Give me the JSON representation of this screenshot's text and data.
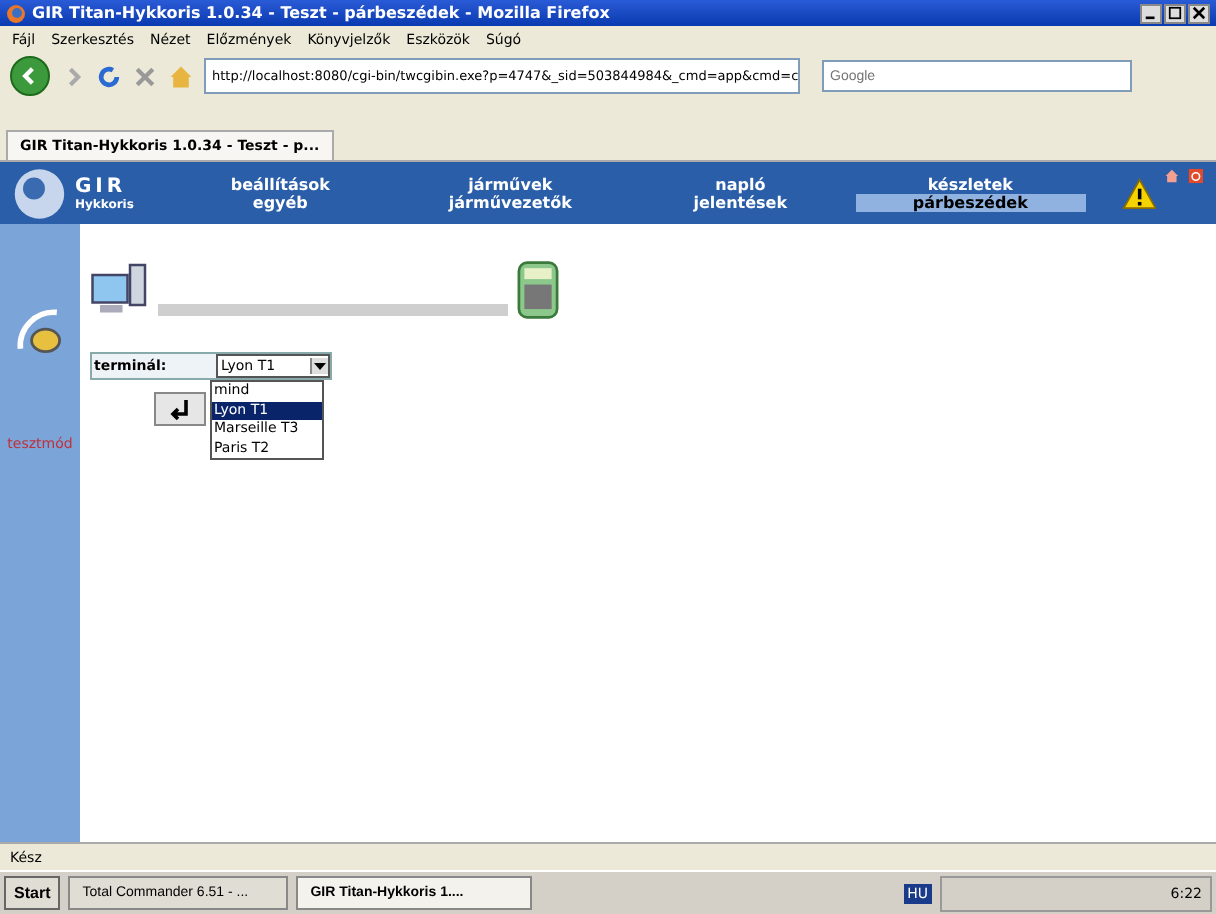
{
  "window": {
    "title": "GIR Titan-Hykkoris 1.0.34 - Teszt - párbeszédek - Mozilla Firefox"
  },
  "menu": [
    "Fájl",
    "Szerkesztés",
    "Nézet",
    "Előzmények",
    "Könyvjelzők",
    "Eszközök",
    "Súgó"
  ],
  "toolbar": {
    "url": "http://localhost:8080/cgi-bin/twcgibin.exe?p=4747&_sid=503844984&_cmd=app&cmd=c",
    "search_placeholder": "Google"
  },
  "tabs": [
    {
      "label": "GIR Titan-Hykkoris 1.0.34 - Teszt - p...",
      "selected": true
    }
  ],
  "app": {
    "logo_title": "GIR",
    "logo_subtitle": "Hykkoris",
    "nav": [
      {
        "label": "beállítások",
        "selected": false
      },
      {
        "label": "járművek",
        "selected": false
      },
      {
        "label": "napló",
        "selected": false
      },
      {
        "label": "készletek",
        "selected": false
      },
      {
        "label": "egyéb",
        "selected": false
      },
      {
        "label": "járművezetők",
        "selected": false
      },
      {
        "label": "jelentések",
        "selected": false
      },
      {
        "label": "párbeszédek",
        "selected": true
      }
    ],
    "sidebar_label": "tesztmód",
    "form": {
      "label": "terminál:",
      "value": "Lyon T1",
      "options": [
        {
          "label": "mind",
          "selected": false
        },
        {
          "label": "Lyon T1",
          "selected": true
        },
        {
          "label": "Marseille T3",
          "selected": false
        },
        {
          "label": "Paris T2",
          "selected": false
        }
      ]
    }
  },
  "status_bar": "Kész",
  "taskbar": {
    "start": "Start",
    "tasks": [
      {
        "label": "Total Commander 6.51 - ...",
        "selected": false
      },
      {
        "label": "GIR Titan-Hykkoris 1....",
        "selected": true
      }
    ],
    "language": "HU",
    "clock": "6:22"
  }
}
